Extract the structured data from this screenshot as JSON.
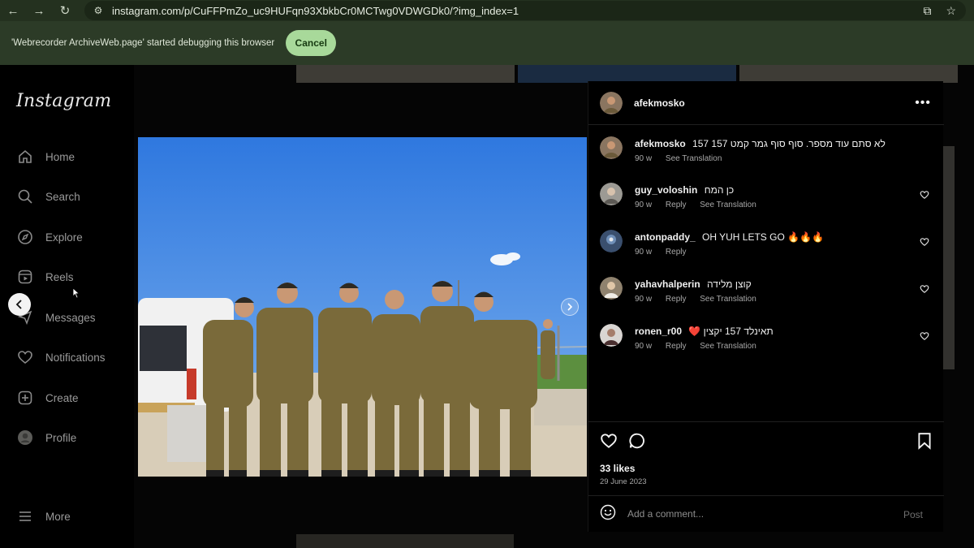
{
  "browser": {
    "url": "instagram.com/p/CuFFPmZo_uc9HUFqn93XbkbCr0MCTwg0VDWGDk0/?img_index=1",
    "infobar_text": "'Webrecorder ArchiveWeb.page' started debugging this browser",
    "cancel_label": "Cancel"
  },
  "sidebar": {
    "logo": "Instagram",
    "items": [
      {
        "label": "Home",
        "icon": "home-icon"
      },
      {
        "label": "Search",
        "icon": "search-icon"
      },
      {
        "label": "Explore",
        "icon": "compass-icon"
      },
      {
        "label": "Reels",
        "icon": "reels-icon"
      },
      {
        "label": "Messages",
        "icon": "messenger-icon"
      },
      {
        "label": "Notifications",
        "icon": "heart-icon"
      },
      {
        "label": "Create",
        "icon": "plus-square-icon"
      },
      {
        "label": "Profile",
        "icon": "profile-avatar"
      }
    ],
    "more_label": "More"
  },
  "post": {
    "author": "afekmosko",
    "caption": "157 לא סתם עוד מספר. סוף סוף גמר קמט 157",
    "caption_age": "90 w",
    "see_translation": "See Translation",
    "likes": "33 likes",
    "date": "29 June 2023",
    "comment_placeholder": "Add a comment...",
    "post_label": "Post"
  },
  "comments": [
    {
      "user": "guy_voloshin",
      "text": "כן המח",
      "age": "90 w",
      "reply": "Reply",
      "translation": "See Translation"
    },
    {
      "user": "antonpaddy_",
      "text": "OH YUH LETS GO 🔥🔥🔥",
      "age": "90 w",
      "reply": "Reply",
      "translation": ""
    },
    {
      "user": "yahavhalperin",
      "text": "קוצן מלידה",
      "age": "90 w",
      "reply": "Reply",
      "translation": "See Translation"
    },
    {
      "user": "ronen_r00",
      "text": "❤️ תאינלד 157 יקצין",
      "age": "90 w",
      "reply": "Reply",
      "translation": "See Translation"
    }
  ],
  "colors": {
    "accent_green": "#a8d99a",
    "chrome_bg": "#24311f",
    "sky": "#3f86e8"
  }
}
